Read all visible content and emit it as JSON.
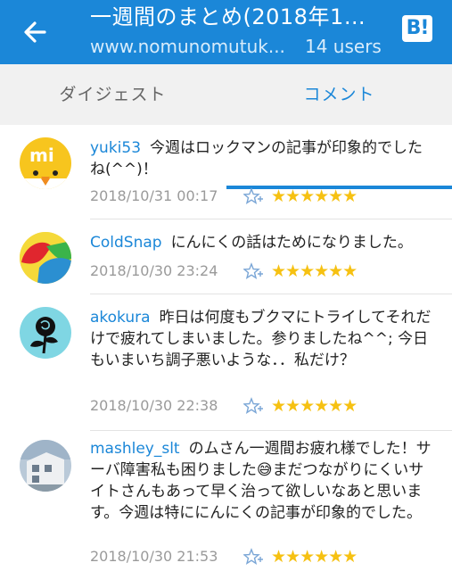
{
  "header": {
    "title": "一週間のまとめ(2018年10...",
    "url": "www.nomunomutuk...",
    "users": "14 users",
    "brand_label": "B!"
  },
  "tabs": [
    {
      "label": "ダイジェスト",
      "active": false
    },
    {
      "label": "コメント",
      "active": true
    }
  ],
  "comments": [
    {
      "user": "yuki53",
      "text": "今週はロックマンの記事が印象的でしたね(^^)！",
      "date": "2018/10/31 00:17",
      "stars": "★★★★★★"
    },
    {
      "user": "ColdSnap",
      "text": "にんにくの話はためになりました。",
      "date": "2018/10/30 23:24",
      "stars": "★★★★★★"
    },
    {
      "user": "akokura",
      "text": "昨日は何度もブクマにトライしてそれだけで疲れてしまいました。参りましたね^^; 今日もいまいち調子悪いような．．私だけ？",
      "date": "2018/10/30 22:38",
      "stars": "★★★★★★"
    },
    {
      "user": "mashley_slt",
      "text": "のムさん一週間お疲れ様でした！サーバ障害私も困りました😅まだつながりにくいサイトさんもあって早く治って欲しいなあと思います。今週は特ににんにくの記事が印象的でした。",
      "date": "2018/10/30 21:53",
      "stars": "★★★★★★"
    }
  ],
  "colors": {
    "accent": "#1b87d8",
    "star": "#f6c112"
  }
}
